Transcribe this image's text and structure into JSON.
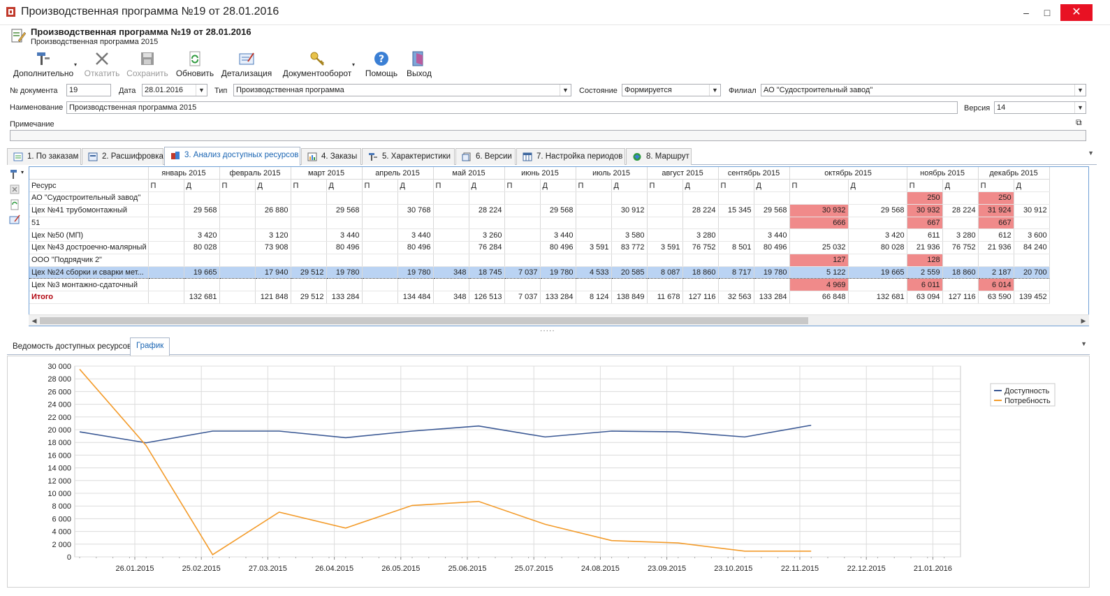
{
  "window": {
    "title": "Производственная программа №19 от 28.01.2016",
    "minimize": "–",
    "maximize": "□",
    "close": "✕"
  },
  "doc": {
    "title": "Производственная программа №19 от 28.01.2016",
    "subtitle": "Производственная программа 2015"
  },
  "toolbar": [
    {
      "label": "Дополнительно",
      "icon": "tools-icon",
      "disabled": false,
      "dropdown": true
    },
    {
      "label": "Откатить",
      "icon": "cross-icon",
      "disabled": true,
      "dropdown": false
    },
    {
      "label": "Сохранить",
      "icon": "save-icon",
      "disabled": true,
      "dropdown": false
    },
    {
      "label": "Обновить",
      "icon": "refresh-icon",
      "disabled": false,
      "dropdown": false
    },
    {
      "label": "Детализация",
      "icon": "detail-icon",
      "disabled": false,
      "dropdown": false
    },
    {
      "label": "Документооборот",
      "icon": "key-icon",
      "disabled": false,
      "dropdown": true
    },
    {
      "label": "Помощь",
      "icon": "help-icon",
      "disabled": false,
      "dropdown": false
    },
    {
      "label": "Выход",
      "icon": "exit-icon",
      "disabled": false,
      "dropdown": false
    }
  ],
  "form": {
    "doc_no_label": "№ документа",
    "doc_no": "19",
    "date_label": "Дата",
    "date": "28.01.2016",
    "type_label": "Тип",
    "type": "Производственная программа",
    "state_label": "Состояние",
    "state": "Формируется",
    "branch_label": "Филиал",
    "branch": "АО \"Судостроительный завод\"",
    "name_label": "Наименование",
    "name": "Производственная программа 2015",
    "version_label": "Версия",
    "version": "14",
    "note_label": "Примечание",
    "note": ""
  },
  "tabs": [
    {
      "label": "1. По заказам",
      "icon": "orders-icon"
    },
    {
      "label": "2. Расшифровка",
      "icon": "decode-icon"
    },
    {
      "label": "3. Анализ доступных ресурсов",
      "icon": "analysis-icon",
      "active": true
    },
    {
      "label": "4. Заказы",
      "icon": "chart-icon"
    },
    {
      "label": "5. Характеристики",
      "icon": "tools-icon"
    },
    {
      "label": "6. Версии",
      "icon": "versions-icon"
    },
    {
      "label": "7. Настройка периодов",
      "icon": "calendar-icon"
    },
    {
      "label": "8. Маршрут",
      "icon": "route-icon"
    }
  ],
  "grid": {
    "resource_header": "Ресурс",
    "months": [
      "январь 2015",
      "февраль 2015",
      "март 2015",
      "апрель 2015",
      "май 2015",
      "июнь 2015",
      "июль 2015",
      "август 2015",
      "сентябрь 2015",
      "октябрь 2015",
      "ноябрь 2015",
      "декабрь 2015"
    ],
    "sub_p": "П",
    "sub_d": "Д",
    "rows": [
      {
        "name": "АО \"Судостроительный завод\"",
        "cells": [
          "",
          "",
          "",
          "",
          "",
          "",
          "",
          "",
          "",
          "",
          "",
          "",
          "",
          "",
          "",
          "",
          "",
          "",
          "",
          "",
          "250",
          "",
          "250",
          ""
        ],
        "red": [
          20,
          22
        ]
      },
      {
        "name": "Цех №41 трубомонтажный",
        "cells": [
          "",
          "29 568",
          "",
          "26 880",
          "",
          "29 568",
          "",
          "30 768",
          "",
          "28 224",
          "",
          "29 568",
          "",
          "30 912",
          "",
          "28 224",
          "15 345",
          "29 568",
          "30 932",
          "29 568",
          "30 932",
          "28 224",
          "31 924",
          "30 912"
        ],
        "red": [
          18,
          20,
          22
        ]
      },
      {
        "name": "51",
        "cells": [
          "",
          "",
          "",
          "",
          "",
          "",
          "",
          "",
          "",
          "",
          "",
          "",
          "",
          "",
          "",
          "",
          "",
          "",
          "666",
          "",
          "667",
          "",
          "667",
          ""
        ],
        "red": [
          18,
          20,
          22
        ]
      },
      {
        "name": "Цех №50 (МП)",
        "cells": [
          "",
          "3 420",
          "",
          "3 120",
          "",
          "3 440",
          "",
          "3 440",
          "",
          "3 260",
          "",
          "3 440",
          "",
          "3 580",
          "",
          "3 280",
          "",
          "3 440",
          "",
          "3 420",
          "611",
          "3 280",
          "612",
          "3 600"
        ],
        "red": []
      },
      {
        "name": "Цех №43 достроечно-малярный",
        "cells": [
          "",
          "80 028",
          "",
          "73 908",
          "",
          "80 496",
          "",
          "80 496",
          "",
          "76 284",
          "",
          "80 496",
          "3 591",
          "83 772",
          "3 591",
          "76 752",
          "8 501",
          "80 496",
          "25 032",
          "80 028",
          "21 936",
          "76 752",
          "21 936",
          "84 240"
        ],
        "red": []
      },
      {
        "name": "ООО \"Подрядчик 2\"",
        "cells": [
          "",
          "",
          "",
          "",
          "",
          "",
          "",
          "",
          "",
          "",
          "",
          "",
          "",
          "",
          "",
          "",
          "",
          "",
          "127",
          "",
          "128",
          "",
          "",
          ""
        ],
        "red": [
          18,
          20
        ]
      },
      {
        "name": "Цех №24 сборки и сварки мет...",
        "cells": [
          "",
          "19 665",
          "",
          "17 940",
          "29 512",
          "19 780",
          "",
          "19 780",
          "348",
          "18 745",
          "7 037",
          "19 780",
          "4 533",
          "20 585",
          "8 087",
          "18 860",
          "8 717",
          "19 780",
          "5 122",
          "19 665",
          "2 559",
          "18 860",
          "2 187",
          "20 700"
        ],
        "red": [],
        "selected": true
      },
      {
        "name": "Цех №3 монтажно-сдаточный",
        "cells": [
          "",
          "",
          "",
          "",
          "",
          "",
          "",
          "",
          "",
          "",
          "",
          "",
          "",
          "",
          "",
          "",
          "",
          "",
          "4 969",
          "",
          "6 011",
          "",
          "6 014",
          ""
        ],
        "red": [
          18,
          20,
          22
        ]
      },
      {
        "name": "Итого",
        "cells": [
          "",
          "132 681",
          "",
          "121 848",
          "29 512",
          "133 284",
          "",
          "134 484",
          "348",
          "126 513",
          "7 037",
          "133 284",
          "8 124",
          "138 849",
          "11 678",
          "127 116",
          "32 563",
          "133 284",
          "66 848",
          "132 681",
          "63 094",
          "127 116",
          "63 590",
          "139 452"
        ],
        "red": [],
        "total": true
      }
    ]
  },
  "bottom_tabs": [
    {
      "label": "Ведомость доступных ресурсов"
    },
    {
      "label": "График",
      "active": true
    }
  ],
  "chart_data": {
    "type": "line",
    "x": [
      "26.01.2015",
      "25.02.2015",
      "27.03.2015",
      "26.04.2015",
      "26.05.2015",
      "25.06.2015",
      "25.07.2015",
      "24.08.2015",
      "23.09.2015",
      "23.10.2015",
      "22.11.2015",
      "22.12.2015",
      "21.01.2016"
    ],
    "series": [
      {
        "name": "Доступность",
        "color": "#3a5894",
        "values": [
          19665,
          17940,
          19780,
          19780,
          18745,
          19780,
          20585,
          18860,
          19780,
          19665,
          18860,
          20700
        ]
      },
      {
        "name": "Потребность",
        "color": "#f39b2a",
        "values": [
          29512,
          17500,
          348,
          7037,
          4533,
          8087,
          8717,
          5122,
          2559,
          2187,
          900,
          900
        ]
      }
    ],
    "series_dates": [
      "2015-01-15",
      "2015-02-15",
      "2015-03-15",
      "2015-04-15",
      "2015-05-15",
      "2015-06-15",
      "2015-07-15",
      "2015-08-15",
      "2015-09-15",
      "2015-10-15",
      "2015-11-15",
      "2015-12-15",
      "2016-01-15"
    ],
    "ylim": [
      0,
      30000
    ],
    "yticks": [
      "0",
      "2 000",
      "4 000",
      "6 000",
      "8 000",
      "10 000",
      "12 000",
      "14 000",
      "16 000",
      "18 000",
      "20 000",
      "22 000",
      "24 000",
      "26 000",
      "28 000",
      "30 000"
    ],
    "grid": true,
    "legend": "top-right",
    "title": "",
    "xlabel": "",
    "ylabel": ""
  }
}
